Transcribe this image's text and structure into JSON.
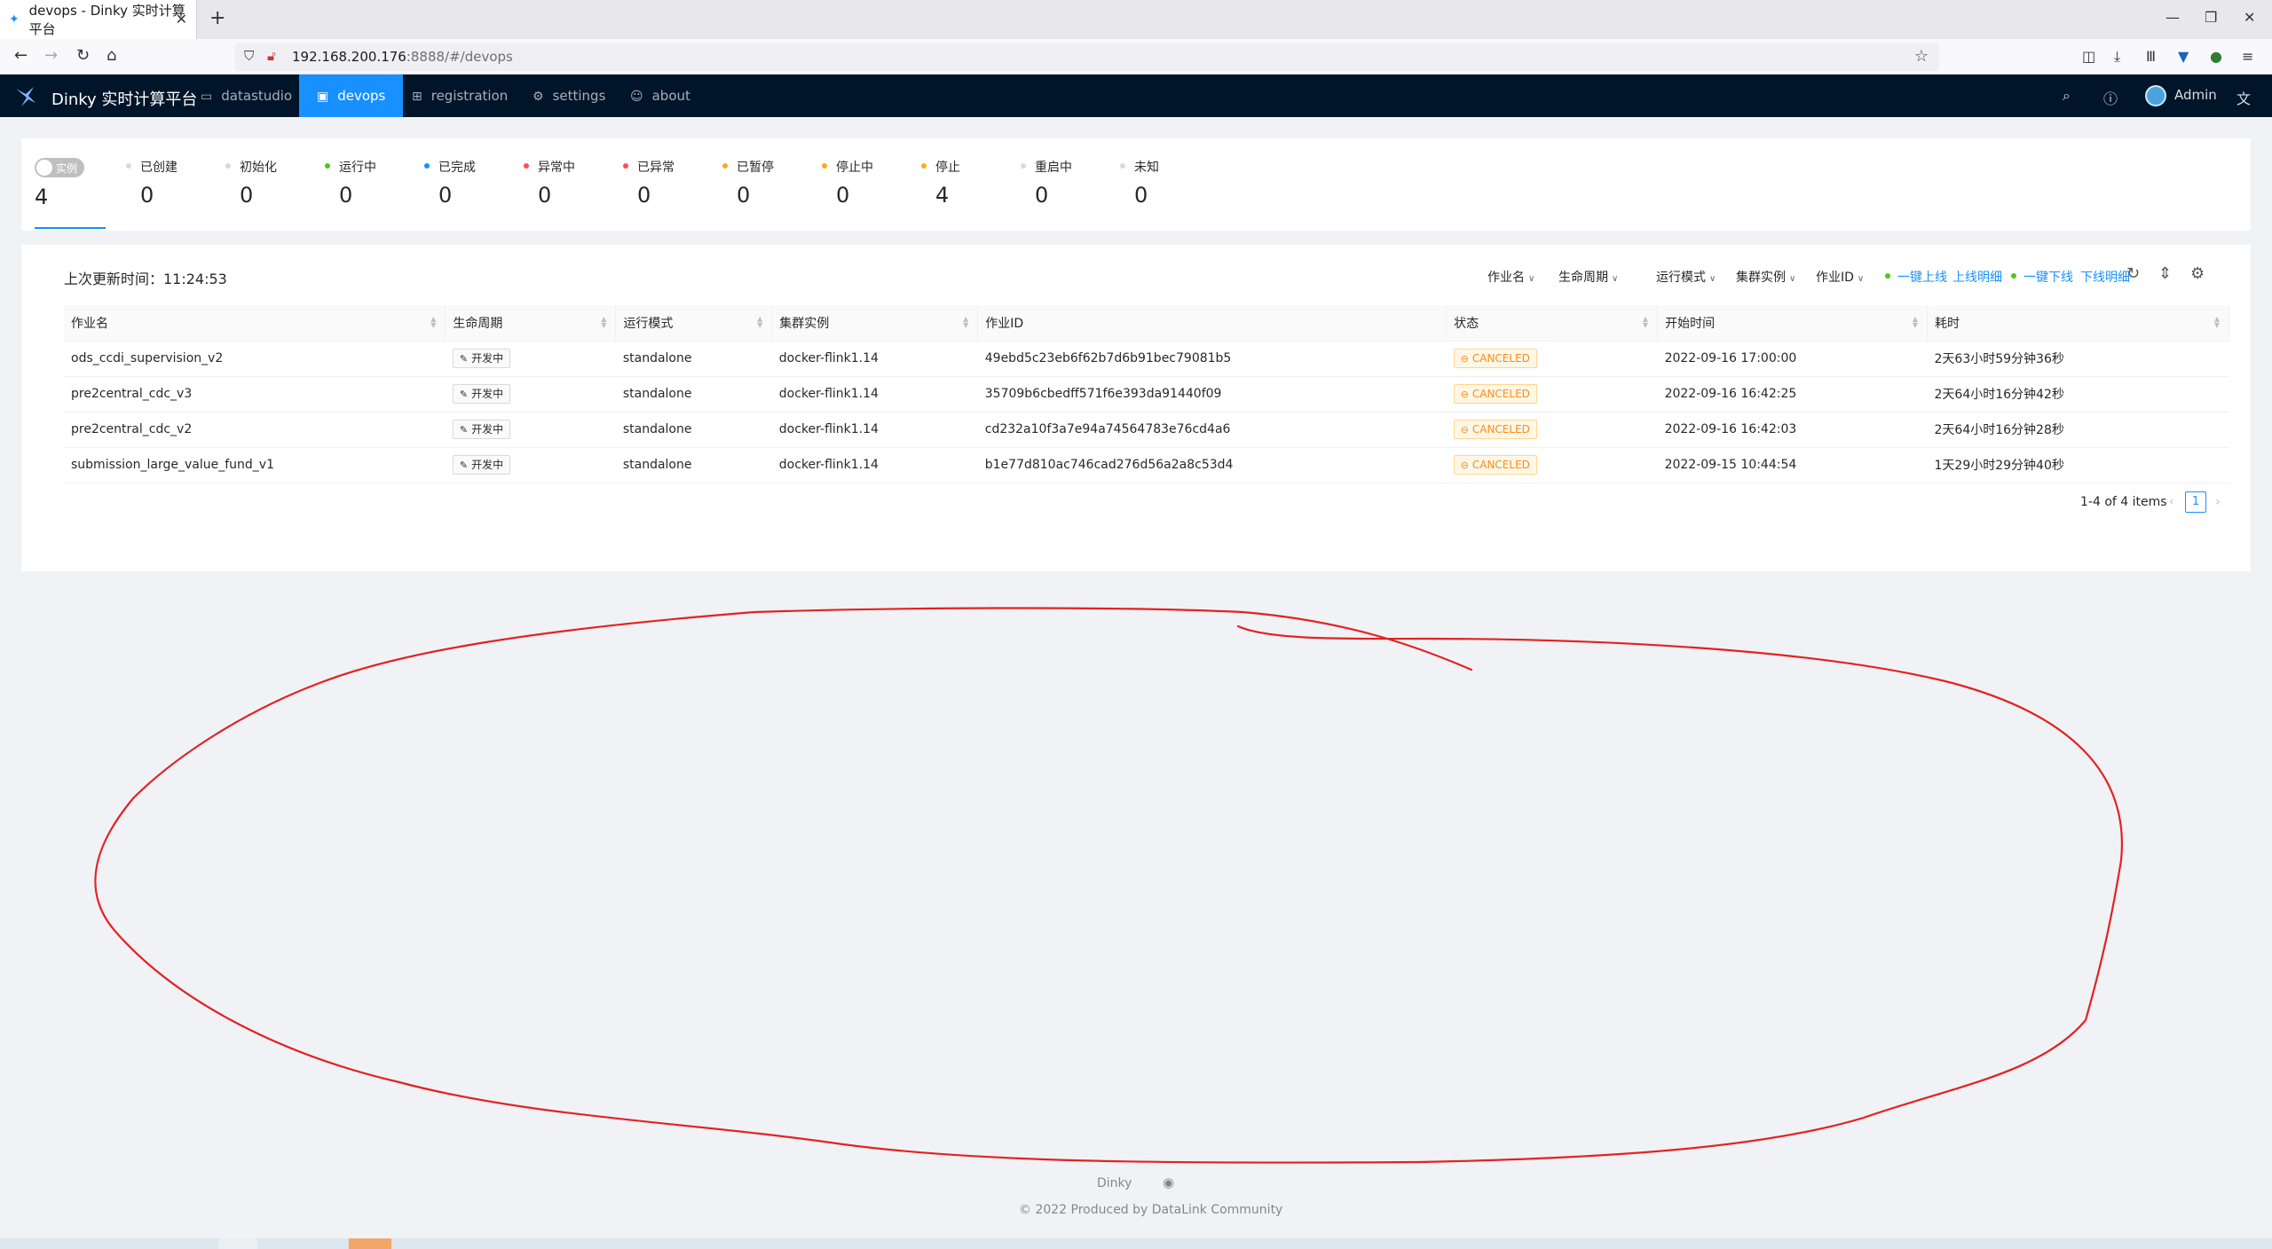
{
  "browser": {
    "tab_title": "devops - Dinky 实时计算平台",
    "url_host": "192.168.200.176",
    "url_rest": ":8888/#/devops"
  },
  "app": {
    "title": "Dinky 实时计算平台",
    "menu": [
      {
        "label": "datastudio",
        "icon": "monitor-icon"
      },
      {
        "label": "devops",
        "icon": "dashboard-icon"
      },
      {
        "label": "registration",
        "icon": "grid-icon"
      },
      {
        "label": "settings",
        "icon": "gear-icon"
      },
      {
        "label": "about",
        "icon": "smile-icon"
      }
    ],
    "user": "Admin"
  },
  "stats": {
    "toggle_label": "实例",
    "total": "4",
    "items": [
      {
        "label": "已创建",
        "value": "0",
        "color": "#d9d9d9"
      },
      {
        "label": "初始化",
        "value": "0",
        "color": "#d9d9d9"
      },
      {
        "label": "运行中",
        "value": "0",
        "color": "#52c41a"
      },
      {
        "label": "已完成",
        "value": "0",
        "color": "#1890ff"
      },
      {
        "label": "异常中",
        "value": "0",
        "color": "#ff4d4f"
      },
      {
        "label": "已异常",
        "value": "0",
        "color": "#ff4d4f"
      },
      {
        "label": "已暂停",
        "value": "0",
        "color": "#faad14"
      },
      {
        "label": "停止中",
        "value": "0",
        "color": "#faad14"
      },
      {
        "label": "停止",
        "value": "4",
        "color": "#faad14"
      },
      {
        "label": "重启中",
        "value": "0",
        "color": "#d9d9d9"
      },
      {
        "label": "未知",
        "value": "0",
        "color": "#d9d9d9"
      }
    ]
  },
  "table": {
    "last_update": "上次更新时间：11:24:53",
    "filters": [
      "作业名",
      "生命周期",
      "运行模式",
      "集群实例",
      "作业ID"
    ],
    "links": [
      "一键上线",
      "上线明细",
      "一键下线",
      "下线明细"
    ],
    "columns": [
      "作业名",
      "生命周期",
      "运行模式",
      "集群实例",
      "作业ID",
      "状态",
      "开始时间",
      "耗时"
    ],
    "rows": [
      {
        "name": "ods_ccdi_supervision_v2",
        "lifecycle": "开发中",
        "mode": "standalone",
        "cluster": "docker-flink1.14",
        "job_id": "49ebd5c23eb6f62b7d6b91bec79081b5",
        "status": "CANCELED",
        "start": "2022-09-16 17:00:00",
        "duration": "2天63小时59分钟36秒"
      },
      {
        "name": "pre2central_cdc_v3",
        "lifecycle": "开发中",
        "mode": "standalone",
        "cluster": "docker-flink1.14",
        "job_id": "35709b6cbedff571f6e393da91440f09",
        "status": "CANCELED",
        "start": "2022-09-16 16:42:25",
        "duration": "2天64小时16分钟42秒"
      },
      {
        "name": "pre2central_cdc_v2",
        "lifecycle": "开发中",
        "mode": "standalone",
        "cluster": "docker-flink1.14",
        "job_id": "cd232a10f3a7e94a74564783e76cd4a6",
        "status": "CANCELED",
        "start": "2022-09-16 16:42:03",
        "duration": "2天64小时16分钟28秒"
      },
      {
        "name": "submission_large_value_fund_v1",
        "lifecycle": "开发中",
        "mode": "standalone",
        "cluster": "docker-flink1.14",
        "job_id": "b1e77d810ac746cad276d56a2a8c53d4",
        "status": "CANCELED",
        "start": "2022-09-15 10:44:54",
        "duration": "1天29小时29分钟40秒"
      }
    ],
    "pagination_summary": "1-4 of 4 items",
    "current_page": "1"
  },
  "footer": {
    "brand": "Dinky",
    "copyright": "© 2022 Produced by DataLink Community"
  }
}
